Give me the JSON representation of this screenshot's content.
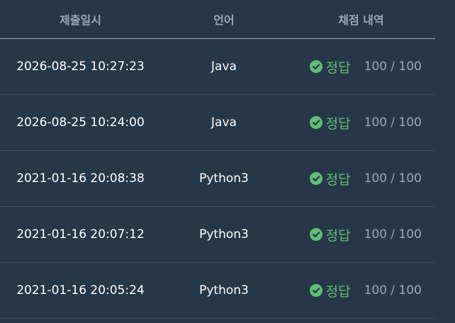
{
  "headers": {
    "date": "제출일시",
    "language": "언어",
    "result": "채점 내역"
  },
  "rows": [
    {
      "date": "2026-08-25 10:27:23",
      "language": "Java",
      "verdict": "정답",
      "score": "100 / 100"
    },
    {
      "date": "2026-08-25 10:24:00",
      "language": "Java",
      "verdict": "정답",
      "score": "100 / 100"
    },
    {
      "date": "2021-01-16 20:08:38",
      "language": "Python3",
      "verdict": "정답",
      "score": "100 / 100"
    },
    {
      "date": "2021-01-16 20:07:12",
      "language": "Python3",
      "verdict": "정답",
      "score": "100 / 100"
    },
    {
      "date": "2021-01-16 20:05:24",
      "language": "Python3",
      "verdict": "정답",
      "score": "100 / 100"
    }
  ],
  "icons": {
    "verdict_icon": "check-circle-icon"
  },
  "colors": {
    "background": "#263747",
    "success": "#5fbf73",
    "muted": "#98a8b9"
  }
}
